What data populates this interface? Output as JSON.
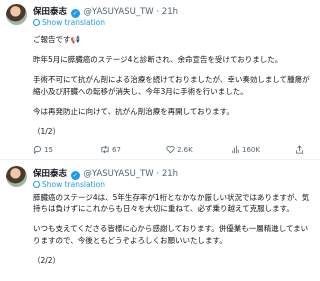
{
  "tweets": [
    {
      "author": "保田泰志",
      "handle": "@YASUYASU_TW",
      "time": "21h",
      "translate": "Show translation",
      "paragraphs": [
        "ご報告です📢",
        "昨年5月に膵臓癌のステージ4と診断され、余命宣告を受けておりました。",
        "手術不可にて抗がん剤による治療を続けておりましたが、幸い奏効しまして腫瘍が縮小及び肝臓への転移が消失し、今年3月に手術を行いました。",
        "今は再発防止に向けて、抗がん剤治療を再開しております。",
        "（1/2）"
      ],
      "stats": {
        "replies": "15",
        "reposts": "67",
        "likes": "2.6K",
        "views": "160K"
      }
    },
    {
      "author": "保田泰志",
      "handle": "@YASUYASU_TW",
      "time": "21h",
      "translate": "Show translation",
      "paragraphs": [
        "膵臓癌のステージ4は、5年生存率が1桁となかなか厳しい状況ではありますが、気持ちは負けずにこれからも日々を大切に重ねて、必ず乗り越えて克服します。",
        "いつも支えてくださる皆様に心から感謝しております。併優業も一層精進してまいりますので、今後ともどうぞよろしくお願いいたします。",
        "（2/2）"
      ]
    }
  ]
}
